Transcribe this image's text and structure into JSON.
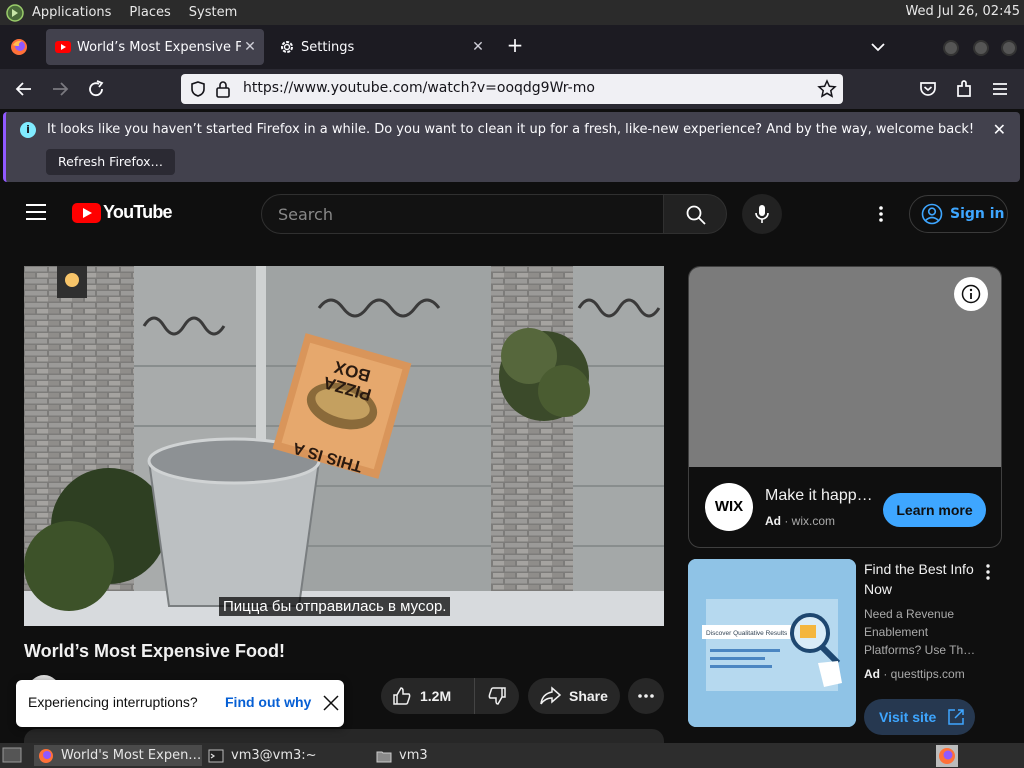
{
  "desktop": {
    "menus": [
      "Applications",
      "Places",
      "System"
    ],
    "clock": "Wed Jul 26, 02:45"
  },
  "browser": {
    "tabs": [
      {
        "title": "World’s Most Expensive Foo",
        "active": true
      },
      {
        "title": "Settings",
        "active": false
      }
    ],
    "url": "https://www.youtube.com/watch?v=ooqdg9Wr-mo",
    "notification": {
      "message": "It looks like you haven’t started Firefox in a while. Do you want to clean it up for a fresh, like-new experience? And by the way, welcome back!",
      "button": "Refresh Firefox…"
    }
  },
  "youtube": {
    "brand": "YouTube",
    "search_placeholder": "Search",
    "sign_in": "Sign in",
    "video": {
      "caption": "Пицца бы отправилась в мусор.",
      "box_text_line1": "THIS IS A",
      "box_text_line2": "PIZZA",
      "box_text_line3": "BOX",
      "title": "World’s Most Expensive Food!"
    },
    "actions": {
      "likes": "1.2M",
      "share": "Share"
    },
    "toast": {
      "text": "Experiencing interruptions?",
      "link": "Find out why"
    },
    "ad1": {
      "logo": "WIX",
      "headline": "Make it happ…",
      "ad_label": "Ad",
      "domain": "wix.com",
      "cta": "Learn more"
    },
    "ad2": {
      "title": "Find the Best Info Now",
      "description": "Need a Revenue Enablement Platforms? Use Th…",
      "ad_label": "Ad",
      "domain": "questtips.com",
      "cta": "Visit site",
      "thumb_text": "Discover Qualitative Results"
    }
  },
  "taskbar": {
    "items": [
      "World's Most Expen…",
      "vm3@vm3:~",
      "vm3"
    ]
  },
  "colors": {
    "yt_red": "#ff0000",
    "yt_blue": "#3ea6ff",
    "firefox_accent": "#9059ff"
  }
}
